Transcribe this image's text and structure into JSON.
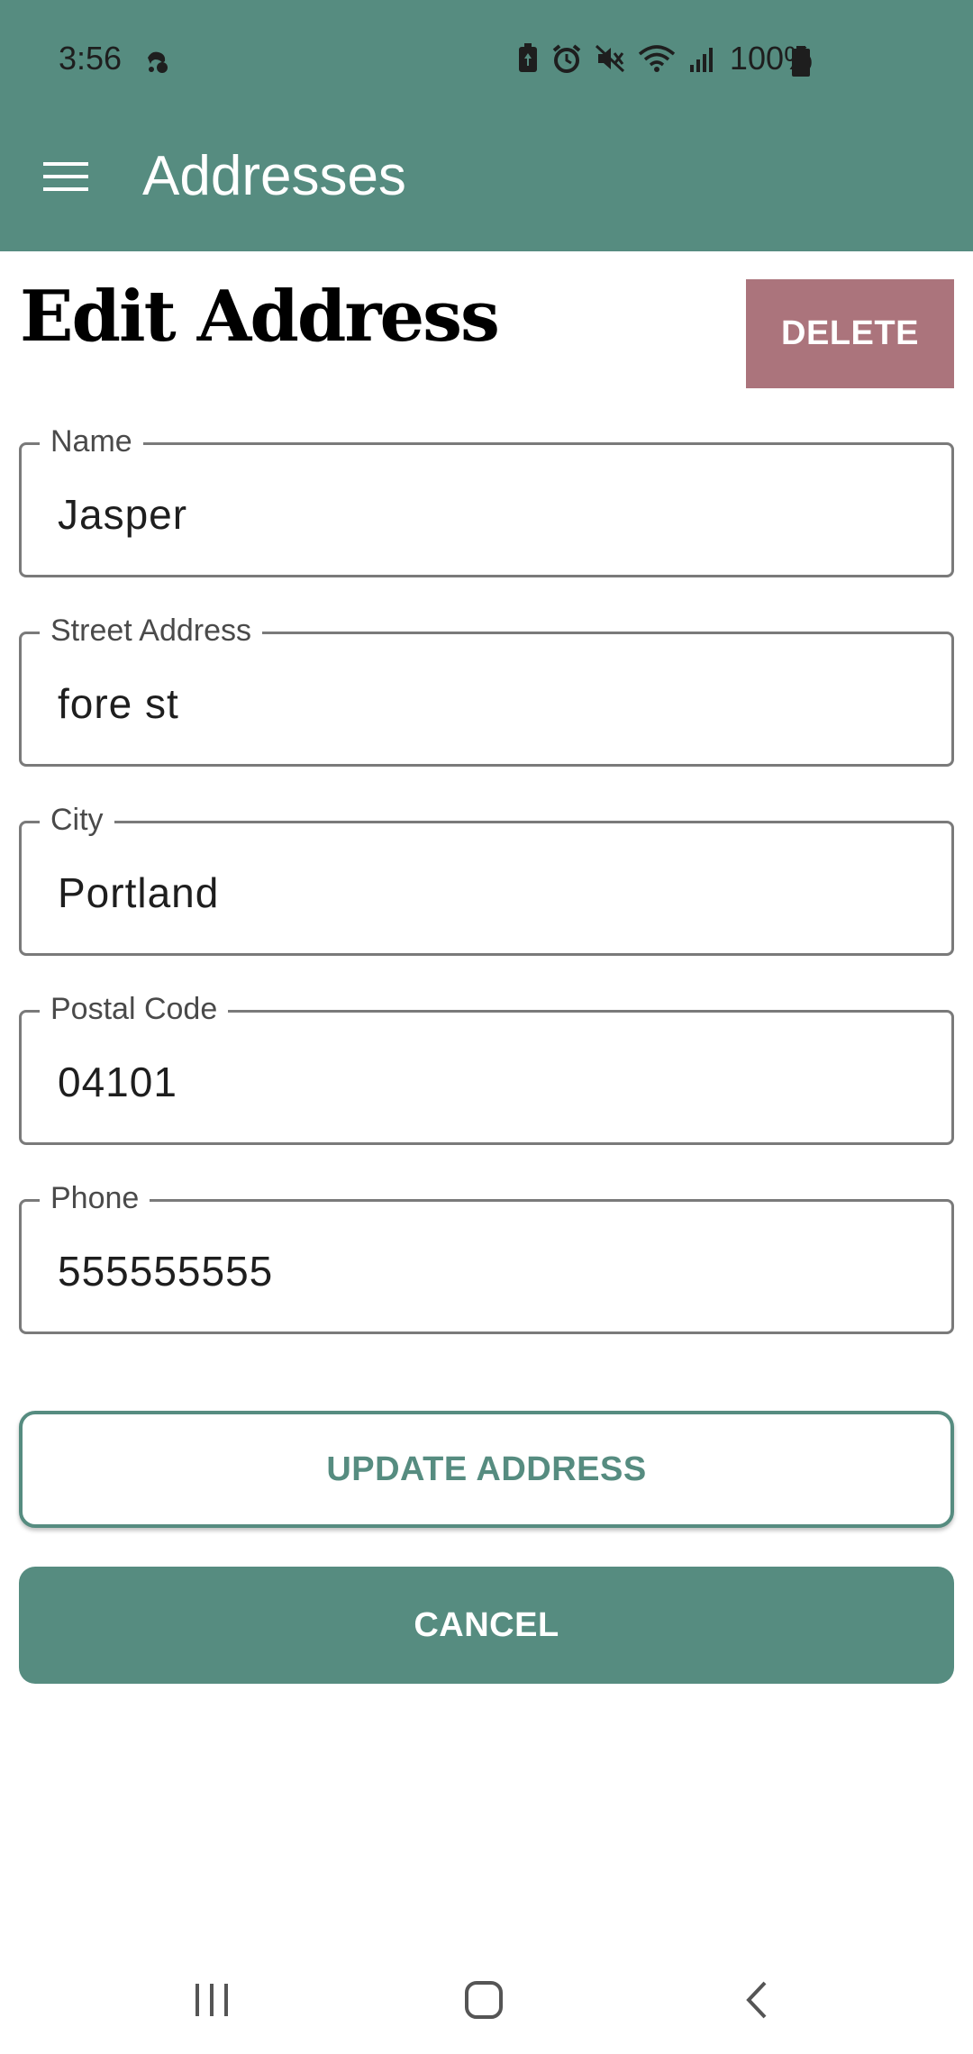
{
  "status_bar": {
    "time": "3:56",
    "battery": "100%",
    "icons": [
      "notification-icon",
      "battery-saver-icon",
      "alarm-icon",
      "mute-icon",
      "wifi-icon",
      "signal-icon",
      "battery-icon"
    ]
  },
  "app_bar": {
    "title": "Addresses",
    "menu_icon": "hamburger-menu-icon"
  },
  "page": {
    "title": "Edit Address",
    "delete_label": "DELETE"
  },
  "form": {
    "fields": [
      {
        "label": "Name",
        "value": "Jasper"
      },
      {
        "label": "Street Address",
        "value": "fore st"
      },
      {
        "label": "City",
        "value": "Portland"
      },
      {
        "label": "Postal Code",
        "value": "04101"
      },
      {
        "label": "Phone",
        "value": "555555555"
      }
    ],
    "update_label": "UPDATE ADDRESS",
    "cancel_label": "CANCEL"
  },
  "nav_bar": {
    "buttons": [
      "recents-icon",
      "home-icon",
      "back-icon"
    ]
  },
  "colors": {
    "primary": "#568c80",
    "delete": "#ab747c",
    "border": "#7a7a7a"
  }
}
